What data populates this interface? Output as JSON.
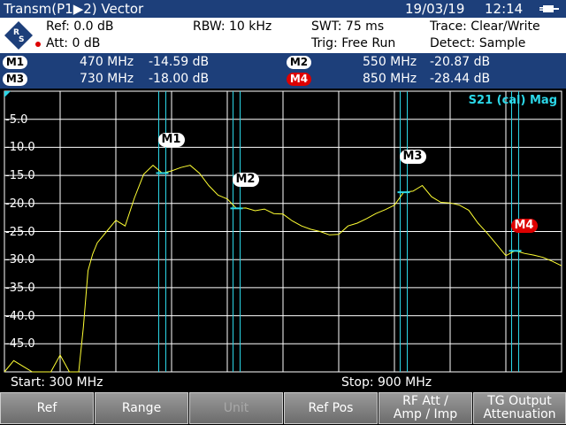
{
  "title": {
    "mode": "Transm(P1▶2) Vector",
    "date": "19/03/19",
    "time": "12:14"
  },
  "settings": {
    "ref": "Ref: 0.0 dB",
    "att": "Att: 0 dB",
    "rbw": "RBW:  10 kHz",
    "swt": "SWT:  75 ms",
    "trig": "Trig:  Free Run",
    "trace": "Trace:  Clear/Write",
    "detect": "Detect:  Sample"
  },
  "markers": [
    {
      "label": "M1",
      "freq": "470 MHz",
      "level": "-14.59 dB",
      "active": false
    },
    {
      "label": "M2",
      "freq": "550 MHz",
      "level": "-20.87 dB",
      "active": false
    },
    {
      "label": "M3",
      "freq": "730 MHz",
      "level": "-18.00 dB",
      "active": false
    },
    {
      "label": "M4",
      "freq": "850 MHz",
      "level": "-28.44 dB",
      "active": true
    }
  ],
  "trace_label": "S21 (cal) Mag",
  "start": "Start:  300 MHz",
  "stop": "Stop:  900 MHz",
  "colors": {
    "header": "#1d3f7a",
    "trace": "#ffff33",
    "grid": "#ffffff",
    "marker_line": "#2bd7e8",
    "active_marker": "#d00000"
  },
  "softkeys": [
    {
      "label": "Ref",
      "enabled": true
    },
    {
      "label": "Range",
      "enabled": true
    },
    {
      "label": "Unit",
      "enabled": false
    },
    {
      "label": "Ref Pos",
      "enabled": true
    },
    {
      "label": "RF Att /\nAmp / Imp",
      "enabled": true
    },
    {
      "label": "TG Output\nAttenuation",
      "enabled": true
    }
  ],
  "chart_data": {
    "type": "line",
    "xlim": [
      300,
      900
    ],
    "ylim": [
      -50,
      0
    ],
    "yticks": [
      -5,
      -10,
      -15,
      -20,
      -25,
      -30,
      -35,
      -40,
      -45
    ],
    "ytick_labels": [
      "-5.0",
      "-10.0",
      "-15.0",
      "-20.0",
      "-25.0",
      "-30.0",
      "-35.0",
      "-40.0",
      "-45.0"
    ],
    "grid": true,
    "series": [
      {
        "x": [
          300,
          310,
          320,
          330,
          340,
          350,
          360,
          370,
          375,
          380,
          385,
          390,
          395,
          400,
          410,
          420,
          430,
          440,
          450,
          460,
          470,
          480,
          490,
          500,
          510,
          520,
          530,
          540,
          550,
          560,
          570,
          580,
          590,
          600,
          610,
          620,
          630,
          640,
          650,
          660,
          670,
          680,
          690,
          700,
          710,
          720,
          730,
          740,
          750,
          760,
          770,
          780,
          790,
          800,
          810,
          820,
          830,
          840,
          850,
          860,
          870,
          880,
          890,
          900
        ],
        "y": [
          -50,
          -48,
          -49,
          -50,
          -50,
          -50,
          -47,
          -50,
          -50,
          -50,
          -42,
          -32,
          -29,
          -27,
          -25,
          -23,
          -24,
          -19,
          -14.8,
          -13.2,
          -14.6,
          -14.2,
          -13.6,
          -13.2,
          -14.6,
          -16.8,
          -18.5,
          -19.2,
          -20.9,
          -20.8,
          -21.3,
          -21.0,
          -21.8,
          -21.9,
          -23.1,
          -24.0,
          -24.6,
          -25.0,
          -25.6,
          -25.5,
          -24.0,
          -23.5,
          -22.7,
          -21.8,
          -21.1,
          -20.3,
          -18.0,
          -17.8,
          -16.8,
          -18.8,
          -19.8,
          -19.9,
          -20.3,
          -21.2,
          -23.5,
          -25.3,
          -27.3,
          -29.3,
          -28.4,
          -28.9,
          -29.2,
          -29.6,
          -30.3,
          -31.1
        ]
      }
    ],
    "markers": [
      {
        "label": "M1",
        "x": 470,
        "y": -14.59
      },
      {
        "label": "M2",
        "x": 550,
        "y": -20.87
      },
      {
        "label": "M3",
        "x": 730,
        "y": -18.0
      },
      {
        "label": "M4",
        "x": 850,
        "y": -28.44
      }
    ]
  }
}
